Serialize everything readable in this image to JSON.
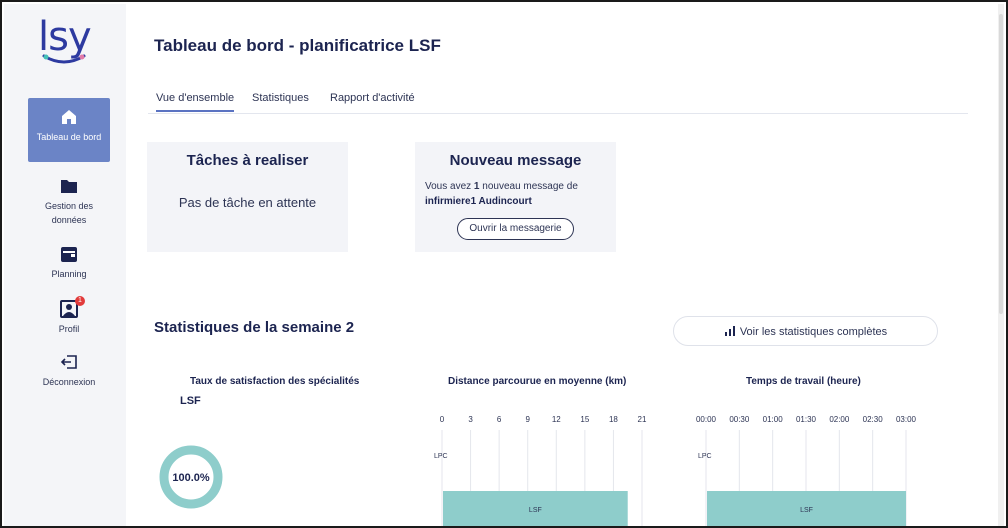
{
  "app": {
    "logo_text": "lsy"
  },
  "sidebar": {
    "items": [
      {
        "label": "Tableau de bord",
        "icon": "home-icon",
        "active": true
      },
      {
        "label": "Gestion des données",
        "icon": "folder-icon",
        "active": false
      },
      {
        "label": "Planning",
        "icon": "calendar-icon",
        "active": false
      },
      {
        "label": "Profil",
        "icon": "profile-icon",
        "badge": "1",
        "active": false
      },
      {
        "label": "Déconnexion",
        "icon": "logout-icon",
        "active": false
      }
    ]
  },
  "header": {
    "title": "Tableau de bord - planificatrice LSF"
  },
  "tabs": [
    {
      "label": "Vue d'ensemble",
      "active": true
    },
    {
      "label": "Statistiques",
      "active": false
    },
    {
      "label": "Rapport d'activité",
      "active": false
    }
  ],
  "tasks_card": {
    "title": "Tâches à realiser",
    "body": "Pas de tâche en attente"
  },
  "message_card": {
    "title": "Nouveau message",
    "line_prefix": "Vous avez ",
    "count": "1",
    "line_suffix": " nouveau message de",
    "sender": "infirmiere1 Audincourt",
    "button_label": "Ouvrir la messagerie"
  },
  "weekly_stats": {
    "title": "Statistiques de la semaine 2",
    "full_stats_button": "Voir les statistiques complètes"
  },
  "colors": {
    "accent": "#6b84c6",
    "bar": "#8ecdcb",
    "donut": "#8ecdcb",
    "badge": "#e23b3b"
  },
  "chart_data": [
    {
      "type": "pie",
      "title": "Taux de satisfaction des spécialités",
      "subtitle": "LSF",
      "values": [
        100.0
      ],
      "center_label": "100.0%"
    },
    {
      "type": "bar",
      "title": "Distance parcourue en moyenne (km)",
      "orientation": "horizontal",
      "x_ticks": [
        "0",
        "3",
        "6",
        "9",
        "12",
        "15",
        "18",
        "21"
      ],
      "xlim": [
        0,
        21
      ],
      "categories": [
        "LPC",
        "LSF"
      ],
      "values": [
        0,
        19.5
      ],
      "bar_labels": [
        "LSF"
      ]
    },
    {
      "type": "bar",
      "title": "Temps de travail (heure)",
      "orientation": "horizontal",
      "x_ticks": [
        "00:00",
        "00:30",
        "01:00",
        "01:30",
        "02:00",
        "02:30",
        "03:00"
      ],
      "xlim": [
        0,
        3
      ],
      "categories": [
        "LPC",
        "LSF"
      ],
      "values": [
        0,
        3
      ],
      "bar_labels": [
        "LSF"
      ]
    }
  ]
}
